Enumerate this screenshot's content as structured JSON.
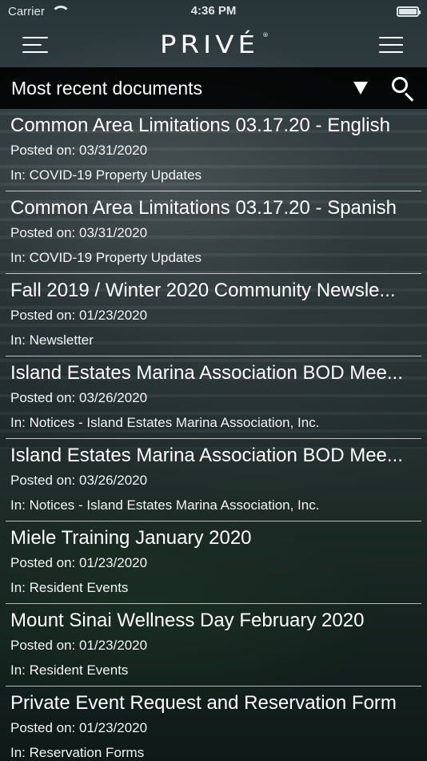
{
  "status_bar": {
    "carrier": "Carrier",
    "time": "4:36 PM"
  },
  "nav": {
    "logo_text": "PRIVÉ",
    "logo_mark": "®",
    "left_icon": "menu-icon",
    "right_icon": "list-menu-icon"
  },
  "filter": {
    "title": "Most recent documents",
    "dropdown_icon": "triangle-down-icon",
    "search_icon": "search-icon"
  },
  "documents": [
    {
      "title": "Common Area Limitations 03.17.20 - English",
      "posted": "Posted on: 03/31/2020",
      "category": "In: COVID-19 Property Updates"
    },
    {
      "title": "Common Area Limitations 03.17.20 - Spanish",
      "posted": "Posted on: 03/31/2020",
      "category": "In: COVID-19 Property Updates"
    },
    {
      "title": "Fall 2019 / Winter 2020 Community Newsle...",
      "posted": "Posted on: 01/23/2020",
      "category": "In: Newsletter"
    },
    {
      "title": "Island Estates Marina Association BOD Mee...",
      "posted": "Posted on: 03/26/2020",
      "category": "In: Notices - Island Estates Marina Association, Inc."
    },
    {
      "title": "Island Estates Marina Association BOD Mee...",
      "posted": "Posted on: 03/26/2020",
      "category": "In: Notices - Island Estates Marina Association, Inc."
    },
    {
      "title": "Miele Training January 2020",
      "posted": "Posted on: 01/23/2020",
      "category": "In: Resident Events"
    },
    {
      "title": "Mount Sinai Wellness Day February 2020",
      "posted": "Posted on: 01/23/2020",
      "category": "In: Resident Events"
    },
    {
      "title": "Private Event Request and Reservation Form",
      "posted": "Posted on: 01/23/2020",
      "category": "In: Reservation Forms"
    }
  ]
}
